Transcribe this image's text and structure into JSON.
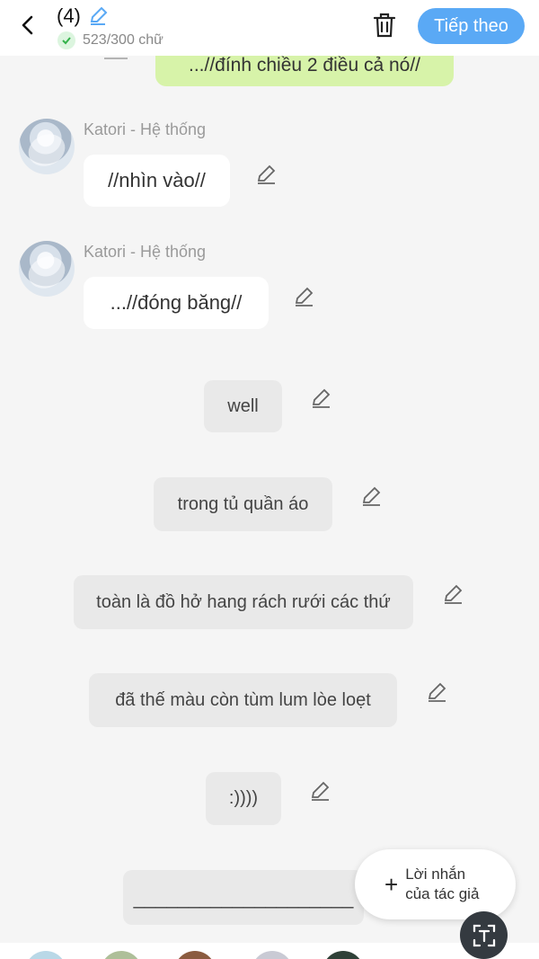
{
  "header": {
    "title": "(4)",
    "word_count": "523/300 chữ",
    "next_label": "Tiếp theo"
  },
  "messages": {
    "top_partial": "...//đính chiều 2 điều cả nó//",
    "sender1": "Katori - Hệ thống",
    "msg1": "//nhìn vào//",
    "sender2": "Katori - Hệ thống",
    "msg2": "...//đóng băng//",
    "grey": [
      "well",
      "trong tủ quần áo",
      "toàn là đồ hở hang rách rưới các thứ",
      "đã thế màu còn tùm lum lòe loẹt",
      ":))))",
      "____________________"
    ]
  },
  "floating": {
    "author_note": "Lời nhắn của tác giả"
  },
  "colors": {
    "accent": "#5aa9f5",
    "green_bubble": "#d7f3a9",
    "background": "#f5f5f5",
    "dark_button": "#343a40"
  },
  "icons": {
    "back": "chevron-left-icon",
    "edit": "pencil-icon",
    "check": "check-icon",
    "trash": "trash-icon",
    "plus": "plus-icon",
    "text": "text-recognition-icon"
  }
}
